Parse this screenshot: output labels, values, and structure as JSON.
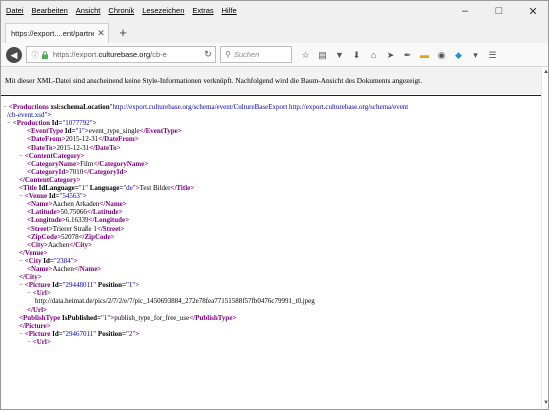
{
  "menu": [
    "Datei",
    "Bearbeiten",
    "Ansicht",
    "Chronik",
    "Lesezeichen",
    "Extras",
    "Hilfe"
  ],
  "window_controls": {
    "minimize": "–",
    "maximize": "□",
    "close": "✕"
  },
  "tab": {
    "title": "https://export....ent/partner.xml",
    "close": "✕"
  },
  "new_tab": "+",
  "urlbar": {
    "prefix": "https://export.",
    "domain": "culturebase.org",
    "suffix": "/cb-e"
  },
  "search": {
    "placeholder": "Suchen"
  },
  "toolbar_icons": [
    "star-icon",
    "bookmarks-library-icon",
    "pocket-icon",
    "download-icon",
    "home-icon",
    "send-icon",
    "brush-icon",
    "notes-icon",
    "mask-icon",
    "addon-icon",
    "overflow-icon",
    "menu-icon"
  ],
  "info_message": "Mit dieser XML-Datei sind anscheinend keine Style-Informationen verknüpft. Nachfolgend wird die Baum-Ansicht des Dokuments angezeigt.",
  "xml_lines": [
    {
      "m": "−",
      "tag": "<Productions",
      "attrs": [
        {
          "n": " xsi:schemaLocation",
          "v": "\"http://export.culturebase.org/schema/event/CultureBaseExport http://export.culturebase.org/schema/event"
        }
      ],
      "end": "",
      "text": ""
    },
    {
      "m": "",
      "tag": "",
      "attrs": [
        {
          "n": "",
          "v": "/cb-event.xsd\""
        }
      ],
      "end": ">",
      "text": ""
    },
    {
      "m": "−",
      "tag": "<Production",
      "attrs": [
        {
          "n": " Id=",
          "v": "\"1077792\""
        }
      ],
      "end": ">",
      "text": ""
    },
    {
      "m": "",
      "tag": "<EventType",
      "attrs": [
        {
          "n": " Id=",
          "v": "\"1\""
        }
      ],
      "end": ">",
      "text": "event_type_single",
      "close": "</EventType>"
    },
    {
      "m": "",
      "tag": "<DateFrom",
      "attrs": [],
      "end": ">",
      "text": "2015-12-31",
      "close": "</DateFrom>"
    },
    {
      "m": "",
      "tag": "<DateTo",
      "attrs": [],
      "end": ">",
      "text": "2015-12-31",
      "close": "</DateTo>"
    },
    {
      "m": "−",
      "tag": "<ContentCategory",
      "attrs": [],
      "end": ">",
      "text": ""
    },
    {
      "m": "",
      "tag": "<CategoryName",
      "attrs": [],
      "end": ">",
      "text": "Film",
      "close": "</CategoryName>"
    },
    {
      "m": "",
      "tag": "<CategoryId",
      "attrs": [],
      "end": ">",
      "text": "7010",
      "close": "</CategoryId>"
    },
    {
      "m": "",
      "tag": "</ContentCategory",
      "attrs": [],
      "end": ">",
      "text": ""
    },
    {
      "m": "",
      "tag": "<Title",
      "attrs": [
        {
          "n": " IdLanguage=",
          "v": "\"1\""
        },
        {
          "n": " Language=",
          "v": "\"de\""
        }
      ],
      "end": ">",
      "text": "Test Bilder",
      "close": "</Title>"
    },
    {
      "m": "−",
      "tag": "<Venue",
      "attrs": [
        {
          "n": " Id=",
          "v": "\"54563\""
        }
      ],
      "end": ">",
      "text": ""
    },
    {
      "m": "",
      "tag": "<Name",
      "attrs": [],
      "end": ">",
      "text": "Aachen Arkaden",
      "close": "</Name>"
    },
    {
      "m": "",
      "tag": "<Latitude",
      "attrs": [],
      "end": ">",
      "text": "50.75066",
      "close": "</Latitude>"
    },
    {
      "m": "",
      "tag": "<Longitude",
      "attrs": [],
      "end": ">",
      "text": "6.16339",
      "close": "</Longitude>"
    },
    {
      "m": "",
      "tag": "<Street",
      "attrs": [],
      "end": ">",
      "text": "Trierer Straße 1",
      "close": "</Street>"
    },
    {
      "m": "",
      "tag": "<ZipCode",
      "attrs": [],
      "end": ">",
      "text": "52078",
      "close": "</ZipCode>"
    },
    {
      "m": "",
      "tag": "<City",
      "attrs": [],
      "end": ">",
      "text": "Aachen",
      "close": "</City>"
    },
    {
      "m": "",
      "tag": "</Venue",
      "attrs": [],
      "end": ">",
      "text": ""
    },
    {
      "m": "−",
      "tag": "<City",
      "attrs": [
        {
          "n": " Id=",
          "v": "\"2384\""
        }
      ],
      "end": ">",
      "text": ""
    },
    {
      "m": "",
      "tag": "<Name",
      "attrs": [],
      "end": ">",
      "text": "Aachen",
      "close": "</Name>"
    },
    {
      "m": "",
      "tag": "</City",
      "attrs": [],
      "end": ">",
      "text": ""
    },
    {
      "m": "−",
      "tag": "<Picture",
      "attrs": [
        {
          "n": " Id=",
          "v": "\"29448011\""
        },
        {
          "n": " Position=",
          "v": "\"1\""
        }
      ],
      "end": ">",
      "text": ""
    },
    {
      "m": "−",
      "tag": "<Url",
      "attrs": [],
      "end": ">",
      "text": ""
    },
    {
      "m": "",
      "tag": "",
      "attrs": [],
      "end": "",
      "text": "http://data.heimat.de/pics/2/7/2/e/7/pic_1450693884_272e78fea77151588f57fb0476c79991_t0.jpeg"
    },
    {
      "m": "",
      "tag": "</Url",
      "attrs": [],
      "end": ">",
      "text": ""
    },
    {
      "m": "",
      "tag": "<PublishType",
      "attrs": [
        {
          "n": " IsPublished=",
          "v": "\"1\""
        }
      ],
      "end": ">",
      "text": "publish_type_for_free_use",
      "close": "</PublishType>"
    },
    {
      "m": "",
      "tag": "</Picture",
      "attrs": [],
      "end": ">",
      "text": ""
    },
    {
      "m": "−",
      "tag": "<Picture",
      "attrs": [
        {
          "n": " Id=",
          "v": "\"29467011\""
        },
        {
          "n": " Position=",
          "v": "\"2\""
        }
      ],
      "end": ">",
      "text": ""
    },
    {
      "m": "−",
      "tag": "<Url",
      "attrs": [],
      "end": ">",
      "text": ""
    }
  ]
}
